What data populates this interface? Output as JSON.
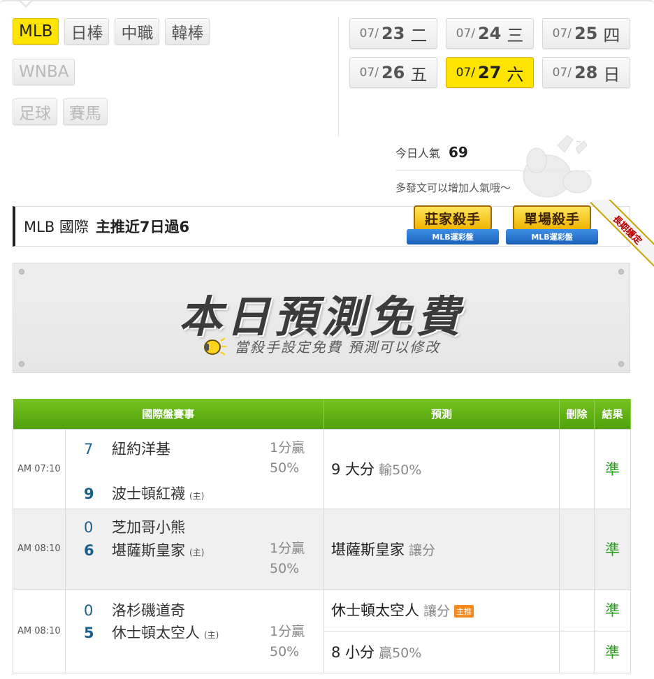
{
  "sport_tabs": [
    {
      "label": "MLB",
      "state": "active"
    },
    {
      "label": "日棒",
      "state": "normal"
    },
    {
      "label": "中職",
      "state": "normal"
    },
    {
      "label": "韓棒",
      "state": "normal"
    },
    {
      "label": "WNBA",
      "state": "faded"
    },
    {
      "label": "足球",
      "state": "faded"
    },
    {
      "label": "賽馬",
      "state": "faded"
    }
  ],
  "dates": [
    {
      "month": "07/",
      "day": "23",
      "weekday": "二",
      "active": false
    },
    {
      "month": "07/",
      "day": "24",
      "weekday": "三",
      "active": false
    },
    {
      "month": "07/",
      "day": "25",
      "weekday": "四",
      "active": false
    },
    {
      "month": "07/",
      "day": "26",
      "weekday": "五",
      "active": false
    },
    {
      "month": "07/",
      "day": "27",
      "weekday": "六",
      "active": true
    },
    {
      "month": "07/",
      "day": "28",
      "weekday": "日",
      "active": false
    }
  ],
  "popularity": {
    "label": "今日人氣",
    "value": "69",
    "hint": "多發文可以增加人氣哦～"
  },
  "league_bar": {
    "name": "MLB 國際",
    "record": "主推近7日過6"
  },
  "badges": [
    {
      "title": "莊家殺手",
      "ribbon": "MLB運彩盤"
    },
    {
      "title": "單場殺手",
      "ribbon": "MLB運彩盤"
    }
  ],
  "long_term_label": "長期穩定",
  "promo": {
    "title": "本日預測免費",
    "subtitle": "當殺手設定免費  預測可以修改",
    "icon": "lightbulb-icon"
  },
  "table": {
    "headers": {
      "match": "國際盤賽事",
      "prediction": "預測",
      "delete": "刪除",
      "result": "結果"
    },
    "games": [
      {
        "time": "AM 07:10",
        "away": {
          "score": "7",
          "name": "紐約洋基",
          "home": ""
        },
        "home": {
          "score": "9",
          "name": "波士頓紅襪",
          "home": "(主)"
        },
        "odds_line1": "1分贏",
        "odds_line2": "50%",
        "picks": [
          {
            "main": "9 大分",
            "sub": "輸50%",
            "tag": "",
            "result": "準"
          }
        ]
      },
      {
        "time": "AM 08:10",
        "away": {
          "score": "0",
          "name": "芝加哥小熊",
          "home": ""
        },
        "home": {
          "score": "6",
          "name": "堪薩斯皇家",
          "home": "(主)"
        },
        "odds_line1": "1分贏",
        "odds_line2": "50%",
        "picks": [
          {
            "main": "堪薩斯皇家",
            "sub": "讓分",
            "tag": "",
            "result": "準"
          }
        ]
      },
      {
        "time": "AM 08:10",
        "away": {
          "score": "0",
          "name": "洛杉磯道奇",
          "home": ""
        },
        "home": {
          "score": "5",
          "name": "休士頓太空人",
          "home": "(主)"
        },
        "odds_line1": "1分贏",
        "odds_line2": "50%",
        "picks": [
          {
            "main": "休士頓太空人",
            "sub": "讓分",
            "tag": "主推",
            "result": "準"
          },
          {
            "main": "8 小分",
            "sub": "贏50%",
            "tag": "",
            "result": "準"
          }
        ]
      }
    ]
  },
  "colors": {
    "accent_yellow": "#ffe400",
    "header_green": "#5aad12",
    "result_green": "#2a9b1d",
    "score_blue": "#1b5f8c",
    "main_tag_orange": "#f58a1f"
  }
}
